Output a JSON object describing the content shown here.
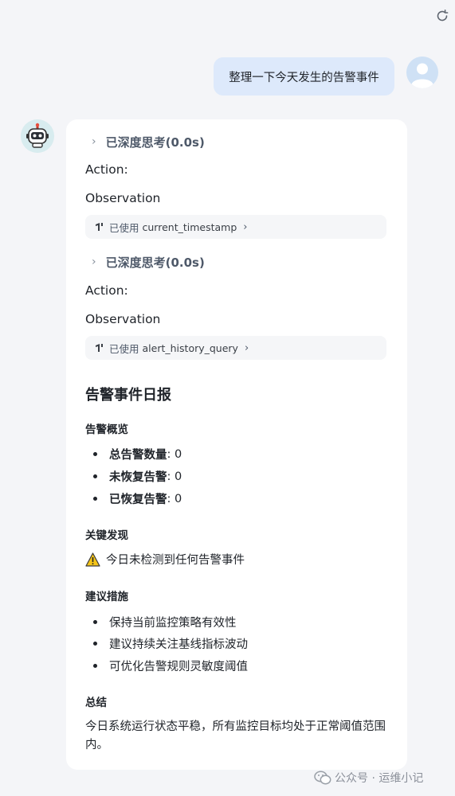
{
  "user_message": "整理一下今天发生的告警事件",
  "steps": [
    {
      "think_label": "已深度思考(0.0s)",
      "action_label": "Action:",
      "observation_label": "Observation",
      "tool_prefix": "已使用",
      "tool_name": "current_timestamp"
    },
    {
      "think_label": "已深度思考(0.0s)",
      "action_label": "Action:",
      "observation_label": "Observation",
      "tool_prefix": "已使用",
      "tool_name": "alert_history_query"
    }
  ],
  "report": {
    "title": "告警事件日报",
    "overview": {
      "heading": "告警概览",
      "items": [
        {
          "key": "总告警数量",
          "value": ": 0"
        },
        {
          "key": "未恢复告警",
          "value": ": 0"
        },
        {
          "key": "已恢复告警",
          "value": ": 0"
        }
      ]
    },
    "findings": {
      "heading": "关键发现",
      "text": "今日未检测到任何告警事件"
    },
    "suggestions": {
      "heading": "建议措施",
      "items": [
        "保持当前监控策略有效性",
        "建议持续关注基线指标波动",
        "可优化告警规则灵敏度阈值"
      ]
    },
    "summary": {
      "heading": "总结",
      "text": "今日系统运行状态平稳，所有监控目标均处于正常阈值范围内。"
    }
  },
  "watermark": "公众号 · 运维小记",
  "icons": {
    "refresh": "refresh-icon",
    "user_avatar": "user-avatar-icon",
    "bot_avatar": "robot-avatar-icon",
    "tool": "tool-icon",
    "warning": "warning-icon",
    "wechat": "wechat-icon"
  },
  "colors": {
    "user_bubble": "#dde9fb",
    "background": "#f4f5f8",
    "card": "#ffffff",
    "warning": "#f5c518"
  }
}
